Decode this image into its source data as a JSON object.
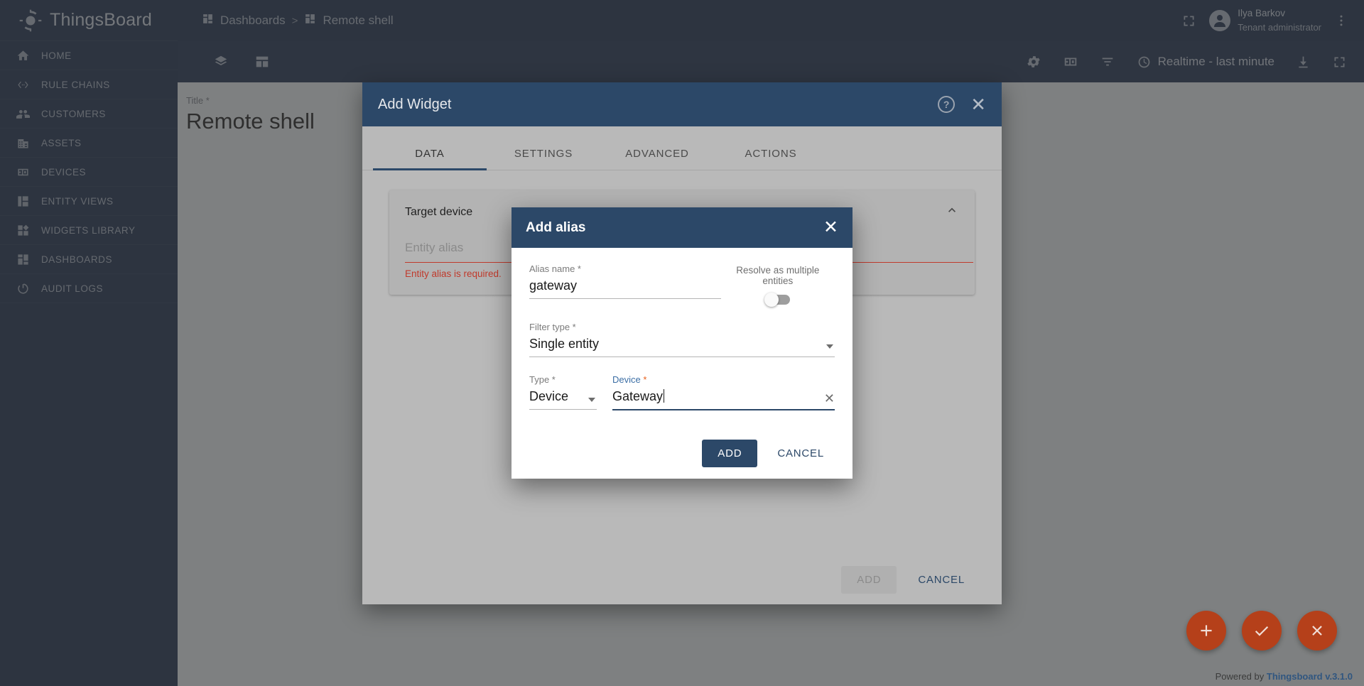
{
  "app": {
    "brand": "ThingsBoard",
    "footer_prefix": "Powered by",
    "footer_link": "Thingsboard v.3.1.0"
  },
  "sidebar": {
    "items": [
      {
        "label": "HOME",
        "icon": "home-icon"
      },
      {
        "label": "RULE CHAINS",
        "icon": "rule-chains-icon"
      },
      {
        "label": "CUSTOMERS",
        "icon": "customers-icon"
      },
      {
        "label": "ASSETS",
        "icon": "assets-icon"
      },
      {
        "label": "DEVICES",
        "icon": "devices-icon"
      },
      {
        "label": "ENTITY VIEWS",
        "icon": "entity-views-icon"
      },
      {
        "label": "WIDGETS LIBRARY",
        "icon": "widgets-library-icon"
      },
      {
        "label": "DASHBOARDS",
        "icon": "dashboards-icon"
      },
      {
        "label": "AUDIT LOGS",
        "icon": "audit-logs-icon"
      }
    ]
  },
  "topbar": {
    "breadcrumb": [
      {
        "label": "Dashboards"
      },
      {
        "label": "Remote shell"
      }
    ],
    "separator": ">",
    "user": {
      "name": "Ilya Barkov",
      "role": "Tenant administrator"
    }
  },
  "toolbar": {
    "timewindow": "Realtime - last minute"
  },
  "dashboard": {
    "title_label": "Title *",
    "title_value": "Remote shell"
  },
  "add_widget_dialog": {
    "title": "Add Widget",
    "tabs": [
      {
        "label": "DATA",
        "active": true
      },
      {
        "label": "SETTINGS",
        "active": false
      },
      {
        "label": "ADVANCED",
        "active": false
      },
      {
        "label": "ACTIONS",
        "active": false
      }
    ],
    "panel": {
      "title": "Target device",
      "alias_placeholder": "Entity alias",
      "alias_error": "Entity alias is required."
    },
    "buttons": {
      "add": "ADD",
      "cancel": "CANCEL"
    }
  },
  "add_alias_dialog": {
    "title": "Add alias",
    "alias_name": {
      "label": "Alias name *",
      "value": "gateway"
    },
    "resolve_toggle": {
      "label": "Resolve as multiple entities",
      "state": "off"
    },
    "filter_type": {
      "label": "Filter type *",
      "value": "Single entity"
    },
    "type": {
      "label": "Type *",
      "value": "Device"
    },
    "device": {
      "label": "Device",
      "required_mark": "*",
      "value": "Gateway"
    },
    "buttons": {
      "add": "ADD",
      "cancel": "CANCEL"
    }
  },
  "fabs": [
    {
      "name": "add-widget-fab",
      "glyph": "+"
    },
    {
      "name": "apply-changes-fab",
      "glyph": "check"
    },
    {
      "name": "discard-changes-fab",
      "glyph": "close"
    }
  ],
  "colors": {
    "brand_dark": "#1b2b45",
    "accent_blue": "#2c4868",
    "error_red": "#c0392b",
    "fab_red": "#b5401a"
  }
}
